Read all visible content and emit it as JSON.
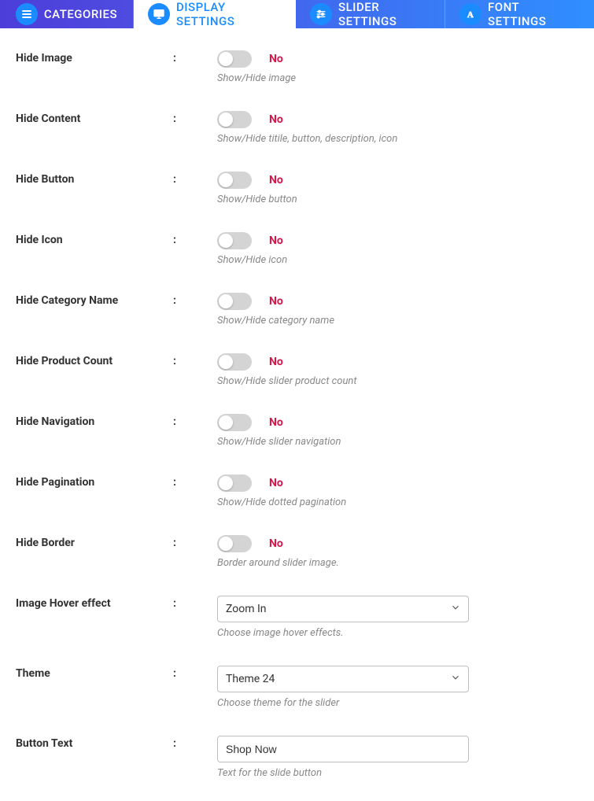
{
  "tabs": {
    "categories": "CATEGORIES",
    "display": "DISPLAY SETTINGS",
    "slider": "SLIDER SETTINGS",
    "font": "FONT SETTINGS"
  },
  "toggle_state_off": "No",
  "settings": {
    "hide_image": {
      "label": "Hide Image",
      "hint": "Show/Hide image"
    },
    "hide_content": {
      "label": "Hide Content",
      "hint": "Show/Hide titile, button, description, icon"
    },
    "hide_button": {
      "label": "Hide Button",
      "hint": "Show/Hide button"
    },
    "hide_icon": {
      "label": "Hide Icon",
      "hint": "Show/Hide icon"
    },
    "hide_category": {
      "label": "Hide Category Name",
      "hint": "Show/Hide category name"
    },
    "hide_product_count": {
      "label": "Hide Product Count",
      "hint": "Show/Hide slider product count"
    },
    "hide_navigation": {
      "label": "Hide Navigation",
      "hint": "Show/Hide slider navigation"
    },
    "hide_pagination": {
      "label": "Hide Pagination",
      "hint": "Show/Hide dotted pagination"
    },
    "hide_border": {
      "label": "Hide Border",
      "hint": "Border around slider image."
    },
    "hover_effect": {
      "label": "Image Hover effect",
      "value": "Zoom In",
      "hint": "Choose image hover effects."
    },
    "theme": {
      "label": "Theme",
      "value": "Theme 24",
      "hint": "Choose theme for the slider"
    },
    "button_text": {
      "label": "Button Text",
      "value": "Shop Now",
      "hint": "Text for the slide button"
    }
  }
}
